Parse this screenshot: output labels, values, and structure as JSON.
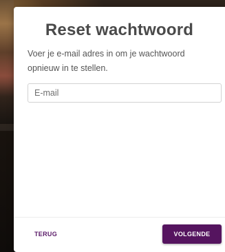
{
  "modal": {
    "title": "Reset wachtwoord",
    "description": "Voer je e-mail adres in om je wachtwoord opnieuw in te stellen.",
    "email_placeholder": "E-mail",
    "email_value": "",
    "back_label": "TERUG",
    "next_label": "VOLGENDE"
  },
  "colors": {
    "primary": "#55145f",
    "link": "#5a1a68",
    "title": "#4a4a4a",
    "text": "#555555",
    "border": "#d2d2d2"
  }
}
